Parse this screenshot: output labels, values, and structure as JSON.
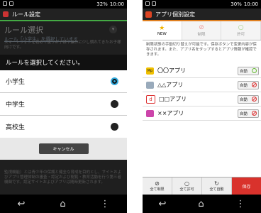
{
  "status": {
    "battery": "32%",
    "time": "10:00"
  },
  "status_right": {
    "battery": "30%",
    "time": "10:00"
  },
  "left": {
    "title": "ルール設定",
    "heading": "ルール選択",
    "sub_link": "ルール「小学生」を選択しています",
    "desc": "スマートフォンを初めて使うお子様や操作に少し慣れてきたお子様向けです。",
    "bottom_text": "監視機能）とは青少年の保護と健全な育成を目的とし、サイトおよびアプリ管理体制の審査・認定および閲覧・教育活動を行う第三者機関です。認定サイトおよびアプリは随時更新されます。",
    "dialog": {
      "title": "ルールを選択してください。",
      "options": [
        "小学生",
        "中学生",
        "高校生"
      ],
      "selected": 0,
      "cancel": "キャンセル"
    }
  },
  "right": {
    "title": "アプリ個別設定",
    "tabs": [
      {
        "label": "NEW",
        "icon": "star-icon"
      },
      {
        "label": "制限",
        "icon": "ban-icon"
      },
      {
        "label": "許可",
        "icon": "circle-icon"
      }
    ],
    "desc": "制限状態の手動切り替えが可能です。保存ボタンで変更内容が保存されます。また、アプリ名をタップするとアプリ情報が確認できます。",
    "apps": [
      {
        "name": "〇〇アプリ",
        "badge": "Mp",
        "badge_color": "#222",
        "status": "自動",
        "allowed": true
      },
      {
        "name": "△△アプリ",
        "badge": "",
        "badge_color": "#9ab",
        "status": "自動",
        "allowed": false
      },
      {
        "name": "□□アプリ",
        "badge": "d",
        "badge_color": "#d33",
        "status": "自動",
        "allowed": false
      },
      {
        "name": "××アプリ",
        "badge": "",
        "badge_color": "#c4a",
        "status": "自動",
        "allowed": false
      }
    ],
    "actions": [
      {
        "label": "全て制限",
        "icon": "ban-icon"
      },
      {
        "label": "全て許可",
        "icon": "circle-icon"
      },
      {
        "label": "全て自動",
        "icon": "auto-icon"
      },
      {
        "label": "保存",
        "icon": ""
      }
    ]
  },
  "colors": {
    "accent_left": "#44aa44",
    "accent_right": "#e08020",
    "save": "#d9322c"
  }
}
